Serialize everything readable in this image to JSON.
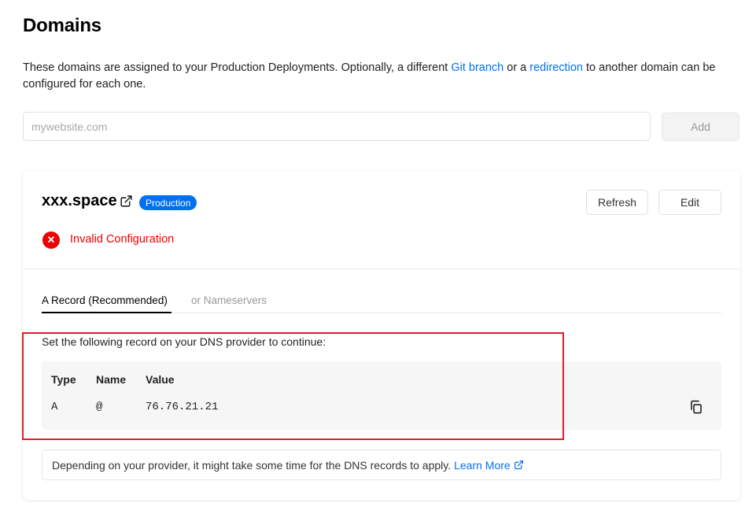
{
  "page": {
    "title": "Domains",
    "description": {
      "text_before": "These domains are assigned to your Production Deployments. Optionally, a different ",
      "link_git_branch": "Git branch",
      "text_middle": " or a ",
      "link_redirection": "redirection",
      "text_after": " to another domain can be configured for each one."
    }
  },
  "add_domain": {
    "placeholder": "mywebsite.com",
    "value": "",
    "button_label": "Add"
  },
  "domain_card": {
    "name": "xxx.space",
    "badge": "Production",
    "refresh_label": "Refresh",
    "edit_label": "Edit",
    "status_text": "Invalid Configuration",
    "tabs": [
      {
        "label": "A Record (Recommended)",
        "active": true
      },
      {
        "label": "or Nameservers",
        "active": false
      }
    ],
    "instruction": "Set the following record on your DNS provider to continue:",
    "record_headers": [
      "Type",
      "Name",
      "Value"
    ],
    "record": {
      "type": "A",
      "name": "@",
      "value": "76.76.21.21"
    },
    "note_text": "Depending on your provider, it might take some time for the DNS records to apply.",
    "note_link": "Learn More"
  },
  "colors": {
    "link": "#0070f3",
    "error": "#ee0000",
    "highlight_box": "#e01e2a"
  },
  "icons": [
    "external-link-icon",
    "error-x-icon",
    "copy-icon"
  ]
}
